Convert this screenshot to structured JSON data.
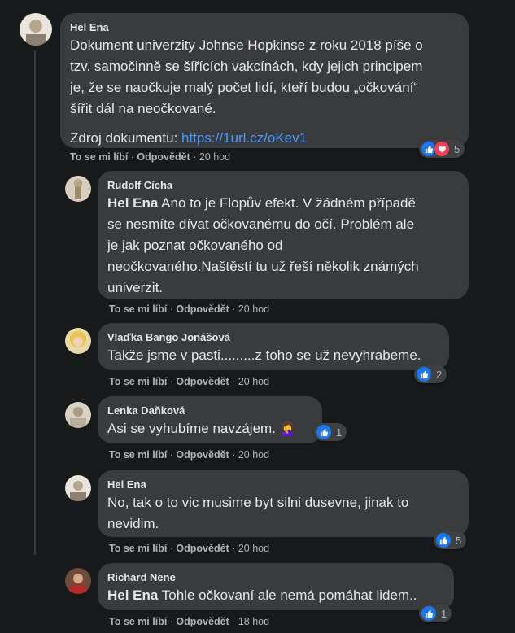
{
  "comments": [
    {
      "author": "Hel Ena",
      "lines": [
        "Dokument univerzity Johnse Hopkinse z roku 2018 píše o",
        "tzv. samočinně se šířících vakcínách, kdy jejich principem",
        "je, že se naočkuje malý počet lidí, kteří budou „očkování“",
        "šířit dál na neočkované."
      ],
      "source_label": "Zdroj dokumentu: ",
      "source_link": "https://1url.cz/oKev1",
      "like": "To se mi líbí",
      "reply": "Odpovědět",
      "time": "20 hod",
      "reactions": "5",
      "reaction_icons": [
        "like-icon",
        "love-icon"
      ]
    },
    {
      "author": "Rudolf Cícha",
      "mention": "Hel Ena",
      "first_line": " Ano to je Flopův efekt. V žádném případě",
      "lines": [
        "se nesmíte dívat očkovanému do očí. Problém ale",
        "je jak poznat očkovaného od",
        "neočkovaného.Naštěstí tu už řeší několik známých",
        "univerzit."
      ],
      "like": "To se mi líbí",
      "reply": "Odpovědět",
      "time": "20 hod"
    },
    {
      "author": "Vlaďka Bango Jonášová",
      "text": "Takže jsme v pasti.........z toho se už nevyhrabeme.",
      "like": "To se mi líbí",
      "reply": "Odpovědět",
      "time": "20 hod",
      "reactions": "2"
    },
    {
      "author": "Lenka Daňková",
      "text": "Asi se vyhubíme navzájem.",
      "emoji": "🤦‍♀️",
      "like": "To se mi líbí",
      "reply": "Odpovědět",
      "time": "20 hod",
      "reactions": "1"
    },
    {
      "author": "Hel Ena",
      "lines": [
        "No, tak o to vic musime byt silni dusevne, jinak to",
        "nevidim."
      ],
      "like": "To se mi líbí",
      "reply": "Odpovědět",
      "time": "20 hod",
      "reactions": "5"
    },
    {
      "author": "Richard Nene",
      "mention": "Hel Ena",
      "first_line": " Tohle očkovaní ale nemá pomáhat lidem..",
      "like": "To se mi líbí",
      "reply": "Odpovědět",
      "time": "18 hod",
      "reactions": "1"
    }
  ],
  "separator": " · ",
  "colors": {
    "background": "#18191a",
    "bubble": "#3a3b3c",
    "link": "#4599ff",
    "like": "#1877f2",
    "love": "#f33e58"
  }
}
